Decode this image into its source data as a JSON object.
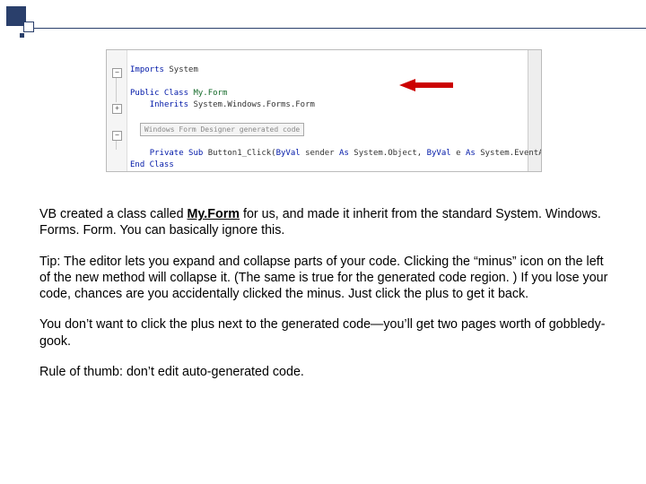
{
  "code": {
    "imports_kw": "Imports",
    "imports_ns": "System",
    "public_kw": "Public Class",
    "class_name": "My.Form",
    "inherits_kw": "Inherits",
    "inherits_ns": "System.Windows.Forms.Form",
    "region_label": "Windows Form Designer generated code",
    "sub_kw": "Private Sub",
    "sub_name": "Button1_Click(",
    "byval1": "ByVal",
    "arg1": " sender ",
    "as1": "As",
    "type1": " System.Object, ",
    "byval2": "ByVal",
    "arg2": " e ",
    "as2": "As",
    "type2": " System.EventAr",
    "end_kw": "End Class",
    "plus1": "+",
    "minus1": "−",
    "minus2": "−"
  },
  "text": {
    "p1a": "VB created a class called ",
    "p1b": "My.Form",
    "p1c": " for us, and made it inherit from the standard System. Windows. Forms. Form.  You can basically ignore this.",
    "p2": "Tip: The editor lets you expand and collapse parts of your code. Clicking the “minus” icon on the left of the new method will collapse it. (The same is true for the generated code region. )  If you lose your code, chances are you accidentally clicked the minus. Just click the plus to get it back.",
    "p3": "You don’t want to click the plus next to the generated code—you’ll get two pages worth of gobbledy-gook.",
    "p4": "Rule of thumb: don’t edit auto-generated code."
  }
}
